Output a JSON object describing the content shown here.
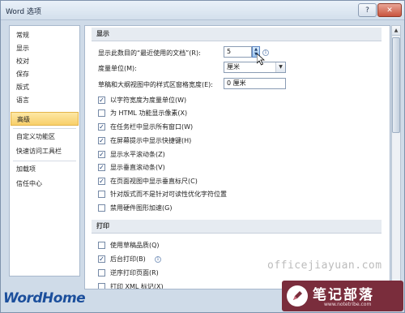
{
  "window": {
    "title": "Word 选项",
    "help_icon": "?",
    "close_icon": "✕"
  },
  "nav": {
    "items": [
      {
        "label": "常规",
        "active": false
      },
      {
        "label": "显示",
        "active": false
      },
      {
        "label": "校对",
        "active": false
      },
      {
        "label": "保存",
        "active": false
      },
      {
        "label": "版式",
        "active": false
      },
      {
        "label": "语言",
        "active": false
      },
      {
        "label": "高级",
        "active": true
      },
      {
        "label": "自定义功能区",
        "active": false
      },
      {
        "label": "快速访问工具栏",
        "active": false
      },
      {
        "label": "加载项",
        "active": false
      },
      {
        "label": "信任中心",
        "active": false
      }
    ]
  },
  "display": {
    "header": "显示",
    "recent_docs_label": "显示此数目的“最近使用的文档”(R):",
    "recent_docs_value": "5",
    "units_label": "度量单位(M):",
    "units_value": "厘米",
    "draft_width_label": "草稿和大纲视图中的样式区窗格宽度(E):",
    "draft_width_value": "0 厘米",
    "checkboxes": [
      {
        "label": "以字符宽度为度量单位(W)",
        "checked": true
      },
      {
        "label": "为 HTML 功能显示像素(X)",
        "checked": false
      },
      {
        "label": "在任务栏中显示所有窗口(W)",
        "checked": true
      },
      {
        "label": "在屏幕提示中显示快捷键(H)",
        "checked": true
      },
      {
        "label": "显示水平滚动条(Z)",
        "checked": true
      },
      {
        "label": "显示垂直滚动条(V)",
        "checked": true
      },
      {
        "label": "在页面视图中显示垂直标尺(C)",
        "checked": true
      },
      {
        "label": "针对版式而不是针对可读性优化字符位置",
        "checked": false
      },
      {
        "label": "禁用硬件图形加速(G)",
        "checked": false
      }
    ]
  },
  "print": {
    "header": "打印",
    "checkboxes": [
      {
        "label": "使用草稿品质(Q)",
        "checked": false
      },
      {
        "label": "后台打印(B)",
        "checked": true
      },
      {
        "label": "逆序打印页面(R)",
        "checked": false
      },
      {
        "label": "打印 XML 标记(X)",
        "checked": false
      }
    ]
  },
  "watermark": {
    "brand": "WordHome",
    "site": "officejiayuan.com",
    "badge_title": "笔记部落",
    "badge_url": "www.notetribe.com"
  },
  "colors": {
    "accent_active": "#f8cf6a",
    "brand_blue": "#1c4f9c",
    "badge_bg": "#7a2d3c"
  }
}
